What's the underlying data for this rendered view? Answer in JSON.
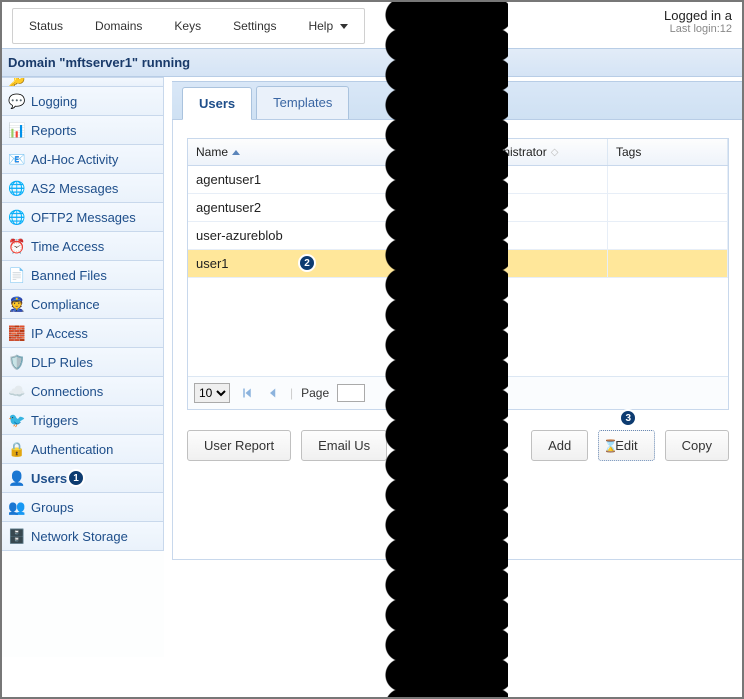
{
  "topmenu": {
    "status": "Status",
    "domains": "Domains",
    "keys": "Keys",
    "settings": "Settings",
    "help": "Help"
  },
  "login_info": {
    "logged_in": "Logged in a",
    "last": "Last login:12"
  },
  "domain_strip": "Domain \"mftserver1\" running",
  "sidebar": {
    "items": [
      "Logging",
      "Reports",
      "Ad-Hoc Activity",
      "AS2 Messages",
      "OFTP2 Messages",
      "Time Access",
      "Banned Files",
      "Compliance",
      "IP Access",
      "DLP Rules",
      "Connections",
      "Triggers",
      "Authentication",
      "Users",
      "Groups",
      "Network Storage"
    ],
    "active_index": 13
  },
  "tabs": {
    "users": "Users",
    "templates": "Templates",
    "active": "users"
  },
  "grid": {
    "columns": {
      "name": "Name",
      "admin": "Administrator",
      "tags": "Tags"
    },
    "rows": [
      {
        "name": "agentuser1",
        "admin": "",
        "tags": ""
      },
      {
        "name": "agentuser2",
        "admin": "",
        "tags": ""
      },
      {
        "name": "user-azureblob",
        "admin": "",
        "tags": ""
      },
      {
        "name": "user1",
        "admin": "",
        "tags": ""
      }
    ],
    "selected_index": 3
  },
  "paging": {
    "page_size": "10",
    "page_label": "Page",
    "page_value": ""
  },
  "buttons": {
    "user_report": "User Report",
    "email_user": "Email Us",
    "add": "Add",
    "edit": "Edit",
    "copy": "Copy"
  },
  "callouts": {
    "one": "1",
    "two": "2",
    "three": "3"
  }
}
